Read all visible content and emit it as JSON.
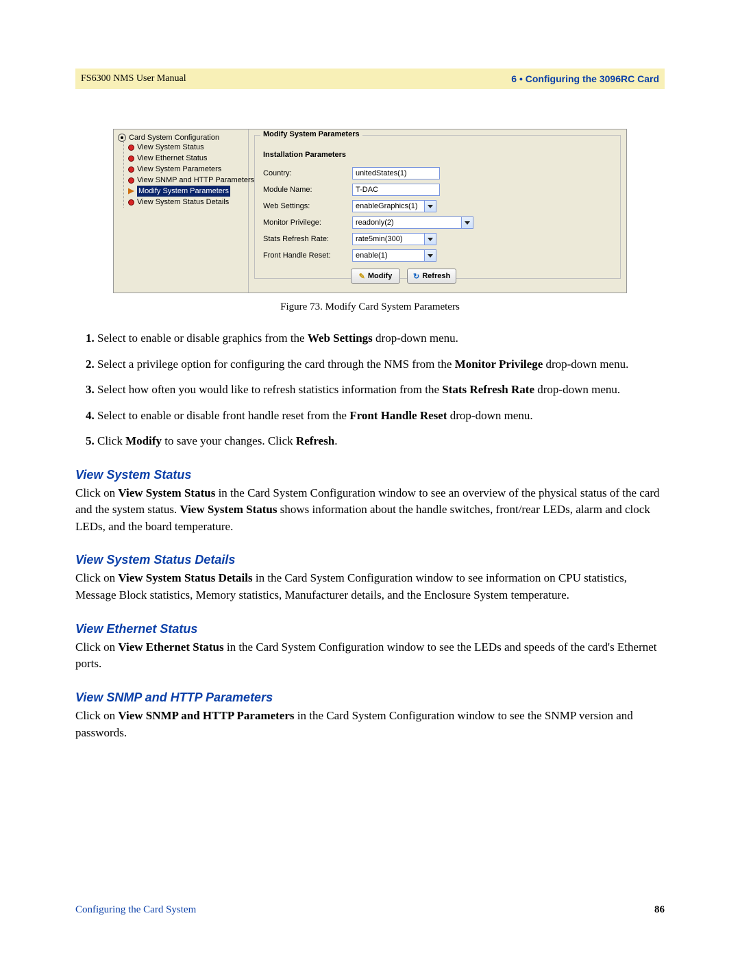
{
  "header": {
    "left": "FS6300 NMS User Manual",
    "right": "6 • Configuring the 3096RC Card"
  },
  "tree": {
    "root": "Card System Configuration",
    "items": [
      {
        "label": "View System Status",
        "selected": false,
        "type": "red"
      },
      {
        "label": "View Ethernet Status",
        "selected": false,
        "type": "red"
      },
      {
        "label": "View System Parameters",
        "selected": false,
        "type": "red"
      },
      {
        "label": "View SNMP and HTTP Parameters",
        "selected": false,
        "type": "red"
      },
      {
        "label": "Modify System Parameters",
        "selected": true,
        "type": "arrow"
      },
      {
        "label": "View System Status Details",
        "selected": false,
        "type": "red"
      }
    ]
  },
  "form": {
    "legend": "Modify System Parameters",
    "subtitle": "Installation Parameters",
    "rows": {
      "country": {
        "label": "Country:",
        "value": "unitedStates(1)"
      },
      "module": {
        "label": "Module Name:",
        "value": "T-DAC"
      },
      "web": {
        "label": "Web Settings:",
        "value": "enableGraphics(1)"
      },
      "monitor": {
        "label": "Monitor Privilege:",
        "value": "readonly(2)"
      },
      "stats": {
        "label": "Stats Refresh Rate:",
        "value": "rate5min(300)"
      },
      "handle": {
        "label": "Front Handle Reset:",
        "value": "enable(1)"
      }
    },
    "buttons": {
      "modify": "Modify",
      "refresh": "Refresh"
    }
  },
  "figure_caption": "Figure 73. Modify Card System Parameters",
  "steps": {
    "s1a": "Select to enable or disable graphics from the ",
    "s1b": "Web Settings",
    "s1c": " drop-down menu.",
    "s2a": "Select a privilege option for configuring the card through the NMS from the ",
    "s2b": "Monitor Privilege",
    "s2c": " drop-down menu.",
    "s3a": "Select how often you would like to refresh statistics information from the ",
    "s3b": "Stats Refresh Rate",
    "s3c": " drop-down menu.",
    "s4a": "Select to enable or disable front handle reset from the ",
    "s4b": "Front Handle Reset",
    "s4c": " drop-down menu.",
    "s5a": "Click ",
    "s5b": "Modify",
    "s5c": " to save your changes. Click ",
    "s5d": "Refresh",
    "s5e": "."
  },
  "sections": {
    "vss": {
      "title": "View System Status",
      "p1": "Click on ",
      "b1": "View System Status",
      "p2": " in the Card System Configuration window to see an overview of the physical status of the card and the system status. ",
      "b2": "View System Status",
      "p3": " shows information about the handle switches, front/rear LEDs, alarm and clock LEDs, and the board temperature."
    },
    "vssd": {
      "title": "View System Status Details",
      "p1": "Click on ",
      "b1": "View System Status Details",
      "p2": " in the Card System Configuration window to see information on CPU statistics, Message Block statistics, Memory statistics, Manufacturer details, and the Enclosure System temperature."
    },
    "ves": {
      "title": "View Ethernet Status",
      "p1": "Click on ",
      "b1": "View Ethernet Status",
      "p2": " in the Card System Configuration window to see the LEDs and speeds of the card's Ethernet ports."
    },
    "vsnmp": {
      "title": "View SNMP and HTTP Parameters",
      "p1": "Click on ",
      "b1": "View SNMP and HTTP Parameters",
      "p2": " in the Card System Configuration window to see the SNMP version and passwords."
    }
  },
  "footer": {
    "left": "Configuring the Card System",
    "right": "86"
  }
}
